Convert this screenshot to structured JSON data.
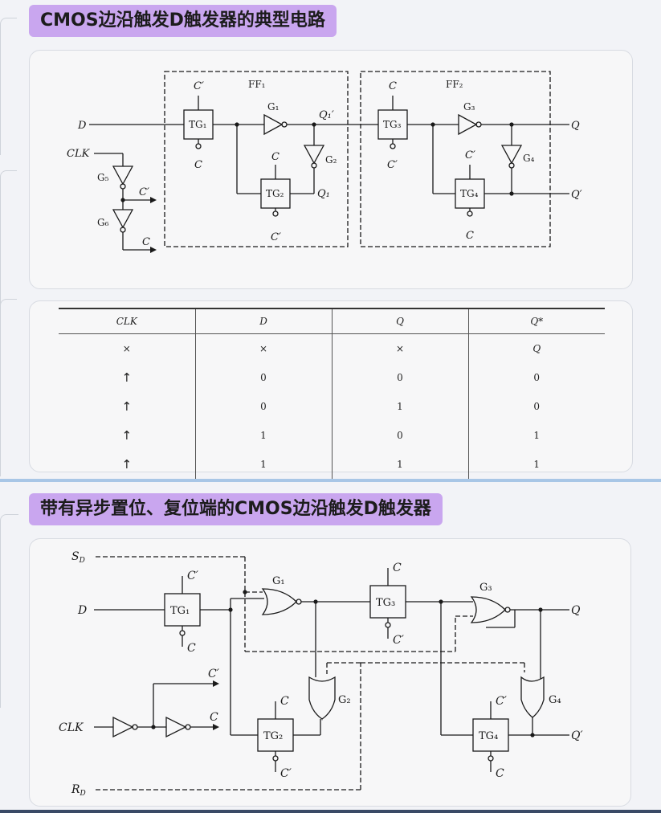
{
  "slide1": {
    "title": "CMOS边沿触发D触发器的典型电路",
    "circuit": {
      "ff1": "FF₁",
      "ff2": "FF₂",
      "d": "D",
      "clk": "CLK",
      "c": "C",
      "c_prime": "C′",
      "q": "Q",
      "q_prime": "Q′",
      "q1": "Q₁",
      "q1_prime": "Q₁′",
      "tg1": "TG₁",
      "tg2": "TG₂",
      "tg3": "TG₃",
      "tg4": "TG₄",
      "g1": "G₁",
      "g2": "G₂",
      "g3": "G₃",
      "g4": "G₄",
      "g5": "G₅",
      "g6": "G₆"
    },
    "truth_table": {
      "headers": [
        "CLK",
        "D",
        "Q",
        "Q*"
      ],
      "rows": [
        [
          "×",
          "×",
          "×",
          "Q"
        ],
        [
          "↑",
          "0",
          "0",
          "0"
        ],
        [
          "↑",
          "0",
          "1",
          "0"
        ],
        [
          "↑",
          "1",
          "0",
          "1"
        ],
        [
          "↑",
          "1",
          "1",
          "1"
        ]
      ]
    }
  },
  "slide2": {
    "title": "带有异步置位、复位端的CMOS边沿触发D触发器",
    "circuit": {
      "sd": "S",
      "sd_sub": "D",
      "rd": "R",
      "rd_sub": "D",
      "d": "D",
      "clk": "CLK",
      "c": "C",
      "c_prime": "C′",
      "q": "Q",
      "q_prime": "Q′",
      "tg1": "TG₁",
      "tg2": "TG₂",
      "tg3": "TG₃",
      "tg4": "TG₄",
      "g1": "G₁",
      "g2": "G₂",
      "g3": "G₃",
      "g4": "G₄"
    }
  }
}
